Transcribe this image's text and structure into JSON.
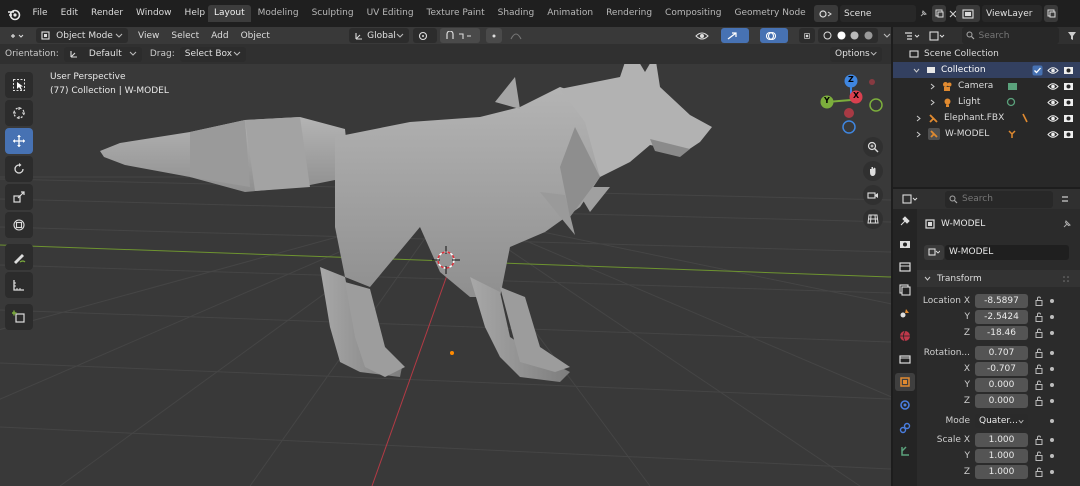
{
  "menubar": {
    "items": [
      "File",
      "Edit",
      "Render",
      "Window",
      "Help"
    ],
    "workspaces": [
      "Layout",
      "Modeling",
      "Sculpting",
      "UV Editing",
      "Texture Paint",
      "Shading",
      "Animation",
      "Rendering",
      "Compositing",
      "Geometry Node"
    ],
    "active_workspace": "Layout",
    "scene": "Scene",
    "view_layer": "ViewLayer"
  },
  "viewport_header": {
    "mode": "Object Mode",
    "menus": [
      "View",
      "Select",
      "Add",
      "Object"
    ],
    "transform_orientation": "Global"
  },
  "tool_header": {
    "orientation_label": "Orientation:",
    "orientation_value": "Default",
    "drag_label": "Drag:",
    "drag_value": "Select Box",
    "options_label": "Options"
  },
  "viewport_overlay": {
    "perspective": "User Perspective",
    "collection": "(77) Collection | W-MODEL"
  },
  "gizmo": {
    "x": "X",
    "y": "Y",
    "z": "Z"
  },
  "outliner": {
    "search_placeholder": "Search",
    "rows": [
      {
        "label": "Scene Collection",
        "icon": "scene-collection-icon"
      },
      {
        "label": "Collection",
        "icon": "collection-icon"
      },
      {
        "label": "Camera",
        "icon": "camera-icon"
      },
      {
        "label": "Light",
        "icon": "light-icon"
      },
      {
        "label": "Elephant.FBX",
        "icon": "armature-icon"
      },
      {
        "label": "W-MODEL",
        "icon": "armature-icon"
      }
    ]
  },
  "properties": {
    "search_placeholder": "Search",
    "object_name": "W-MODEL",
    "data_name": "W-MODEL",
    "transform_label": "Transform",
    "location": {
      "label": "Location X",
      "x": "-8.5897",
      "y": "-2.5424",
      "z": "-18.46"
    },
    "rotation": {
      "label": "Rotation...",
      "w": "0.707",
      "x": "-0.707",
      "y": "0.000",
      "z": "0.000"
    },
    "mode": {
      "label": "Mode",
      "value": "Quater..."
    },
    "scale": {
      "label": "Scale X",
      "x": "1.000",
      "y": "1.000",
      "z": "1.000"
    },
    "axis_labels": {
      "y": "Y",
      "z": "Z",
      "x": "X"
    }
  },
  "colors": {
    "accent": "#4772b3",
    "x_axis": "#d9404f",
    "y_axis": "#7cae3c",
    "z_axis": "#3f86e0",
    "origin": "#ff8a00"
  }
}
